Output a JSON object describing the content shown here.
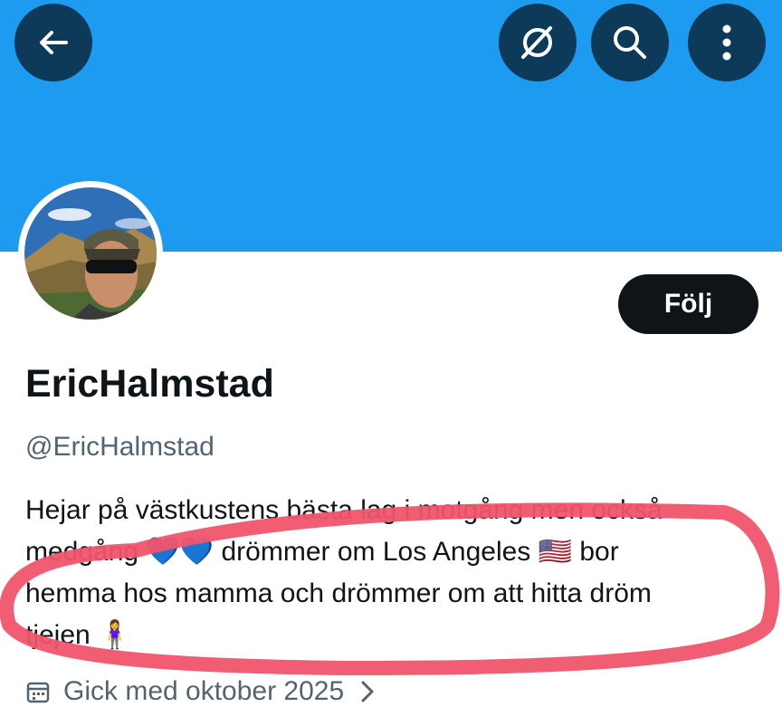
{
  "profile": {
    "display_name": "EricHalmstad",
    "handle": "@EricHalmstad",
    "follow_label": "Följ",
    "bio_lines": [
      "Hejar på västkustens bästa lag i motgång men också",
      "medgång 💙💙 drömmer om Los Angeles 🇺🇸 bor",
      "hemma hos mamma och drömmer om att hitta dröm",
      "tjejen 🧍‍♀️"
    ],
    "joined": "Gick med oktober 2025"
  },
  "icons": {
    "back": "arrow-left-icon",
    "grok": "grok-icon",
    "search": "search-icon",
    "more": "more-vertical-icon",
    "calendar": "calendar-icon",
    "chevron": "chevron-right-icon"
  },
  "colors": {
    "banner": "#1d9bf0",
    "header_button": "#0e3a5a",
    "follow_button": "#0f1419",
    "secondary_text": "#536471",
    "annotation": "#f0546b"
  }
}
